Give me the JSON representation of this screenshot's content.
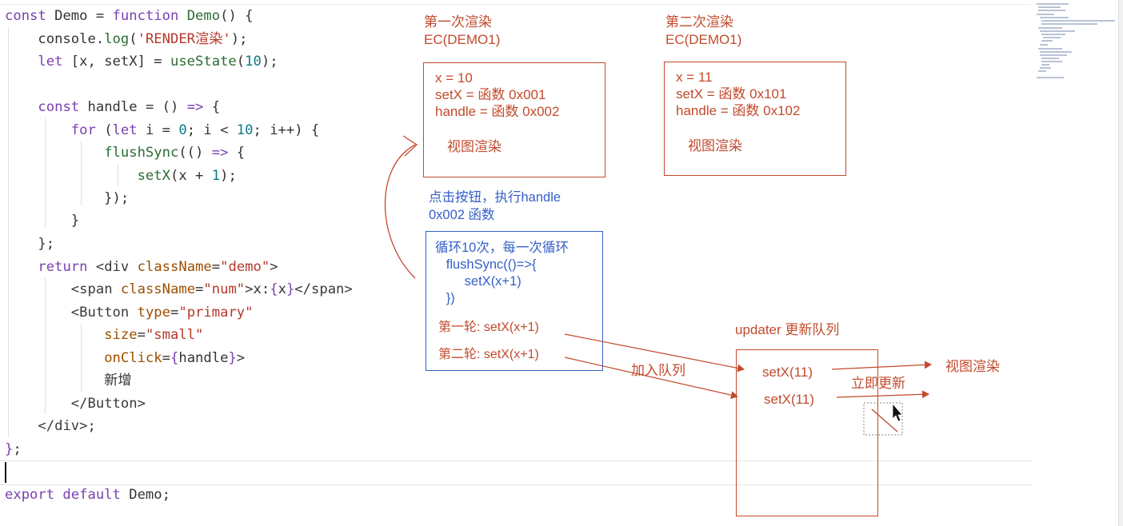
{
  "editor": {
    "lines": [
      "const Demo = function Demo() {",
      "    console.log('RENDER渲染');",
      "    let [x, setX] = useState(10);",
      "",
      "    const handle = () => {",
      "        for (let i = 0; i < 10; i++) {",
      "            flushSync(() => {",
      "                setX(x + 1);",
      "            });",
      "        }",
      "    };",
      "    return <div className=\"demo\">",
      "        <span className=\"num\">x:{x}</span>",
      "        <Button type=\"primary\"",
      "            size=\"small\"",
      "            onClick={handle}>",
      "            新增",
      "        </Button>",
      "    </div>;",
      "};",
      "",
      "export default Demo;"
    ]
  },
  "render1": {
    "title": "第一次渲染",
    "context": "EC(DEMO1)",
    "lines": [
      "x = 10",
      "setX = 函数 0x001",
      "handle = 函数 0x002"
    ],
    "view": "视图渲染"
  },
  "render2": {
    "title": "第二次渲染",
    "context": "EC(DEMO1)",
    "lines": [
      "x = 11",
      "setX = 函数 0x101",
      "handle = 函数 0x102"
    ],
    "view": "视图渲染"
  },
  "click": {
    "lines": [
      "点击按钮，执行handle",
      "0x002 函数"
    ]
  },
  "loop": {
    "lines": [
      "循环10次，每一次循环",
      "   flushSync(()=>{",
      "        setX(x+1)",
      "   })"
    ],
    "round1": "第一轮: setX(x+1)",
    "round2": "第二轮: setX(x+1)"
  },
  "queue": {
    "title": "updater 更新队列",
    "items": [
      "setX(11)",
      "setX(11)"
    ],
    "enqueue": "加入队列",
    "immediate": "立即更新",
    "render": "视图渲染"
  },
  "colors": {
    "annotation_red": "#c24a2c",
    "annotation_blue": "#3560c8"
  }
}
